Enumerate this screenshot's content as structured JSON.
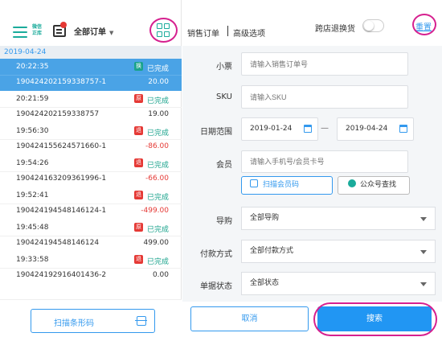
{
  "header": {
    "logo_text": "微信 正库",
    "order_select": "全部订单"
  },
  "list": {
    "date": "2019-04-24",
    "items": [
      {
        "time": "20:22:35",
        "order_no": "190424202159338757-1",
        "amount": "20.00",
        "badge": "换",
        "badge_color": "#1aa38c",
        "status": "已完成",
        "selected": true
      },
      {
        "time": "20:21:59",
        "order_no": "190424202159338757",
        "amount": "19.00",
        "badge": "原",
        "badge_color": "#e53935",
        "status": "已完成"
      },
      {
        "time": "19:56:30",
        "order_no": "190424155624571660-1",
        "amount": "-86.00",
        "badge": "退",
        "badge_color": "#e53935",
        "status": "已完成"
      },
      {
        "time": "19:54:26",
        "order_no": "190424163209361996-1",
        "amount": "-66.00",
        "badge": "退",
        "badge_color": "#e53935",
        "status": "已完成"
      },
      {
        "time": "19:52:41",
        "order_no": "190424194548146124-1",
        "amount": "-499.00",
        "badge": "退",
        "badge_color": "#e53935",
        "status": "已完成"
      },
      {
        "time": "19:45:48",
        "order_no": "190424194548146124",
        "amount": "499.00",
        "badge": "原",
        "badge_color": "#e53935",
        "status": "已完成"
      },
      {
        "time": "19:33:58",
        "order_no": "190424192916401436-2",
        "amount": "0.00",
        "badge": "退",
        "badge_color": "#e53935",
        "status": "已完成"
      }
    ],
    "scan_button": "扫描条形码"
  },
  "right_header": {
    "tab_sales": "销售订单",
    "tab_advanced": "高级选项",
    "cross_store_label": "跨店退换货",
    "reset": "重置"
  },
  "form": {
    "receipt_label": "小票",
    "receipt_placeholder": "请输入销售订单号",
    "sku_label": "SKU",
    "sku_placeholder": "请输入SKU",
    "date_label": "日期范围",
    "date_from": "2019-01-24",
    "date_to": "2019-04-24",
    "date_sep": "—",
    "member_label": "会员",
    "member_placeholder": "请输入手机号/会员卡号",
    "scan_member_button": "扫描会员码",
    "public_account_button": "公众号查找",
    "guide_label": "导购",
    "guide_value": "全部导购",
    "payment_label": "付款方式",
    "payment_value": "全部付款方式",
    "status_label": "单据状态",
    "status_value": "全部状态"
  },
  "actions": {
    "cancel": "取消",
    "search": "搜索"
  },
  "colors": {
    "accent": "#3399ee",
    "brand_green": "#1aab9b",
    "highlight": "#d6208f"
  }
}
